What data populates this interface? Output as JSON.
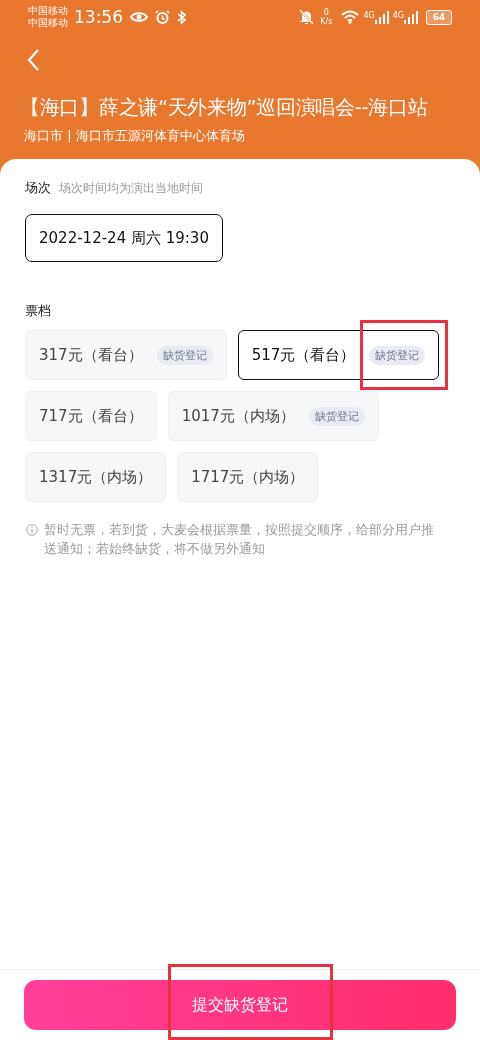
{
  "status_bar": {
    "carriers": [
      "中国移动",
      "中国移动"
    ],
    "time": "13:56",
    "speed_value": "0",
    "speed_unit": "K/s",
    "network_labels": [
      "4G",
      "4G"
    ],
    "battery": "64"
  },
  "header": {
    "title": "【海口】薛之谦“天外来物”巡回演唱会--海口站",
    "venue": "海口市 | 海口市五源河体育中心体育场"
  },
  "session": {
    "label": "场次",
    "hint": "场次时间均为演出当地时间",
    "options": [
      {
        "text": "2022-12-24 周六 19:30",
        "selected": true
      }
    ]
  },
  "tickets": {
    "label": "票档",
    "items": [
      {
        "price": "317元（看台）",
        "tag": "缺货登记",
        "selected": false,
        "highlighted": false
      },
      {
        "price": "517元（看台）",
        "tag": "缺货登记",
        "selected": true,
        "highlighted": true
      },
      {
        "price": "717元（看台）",
        "selected": false,
        "highlighted": false
      },
      {
        "price": "1017元（内场）",
        "tag": "缺货登记",
        "selected": false,
        "highlighted": false
      },
      {
        "price": "1317元（内场）",
        "selected": false,
        "highlighted": false
      },
      {
        "price": "1717元（内场）",
        "selected": false,
        "highlighted": false
      }
    ]
  },
  "notice": "暂时无票，若到货，大麦会根据票量，按照提交顺序，给部分用户推送通知；若始终缺货，将不做另外通知",
  "submit_button": {
    "label": "提交缺货登记",
    "highlighted": true
  }
}
